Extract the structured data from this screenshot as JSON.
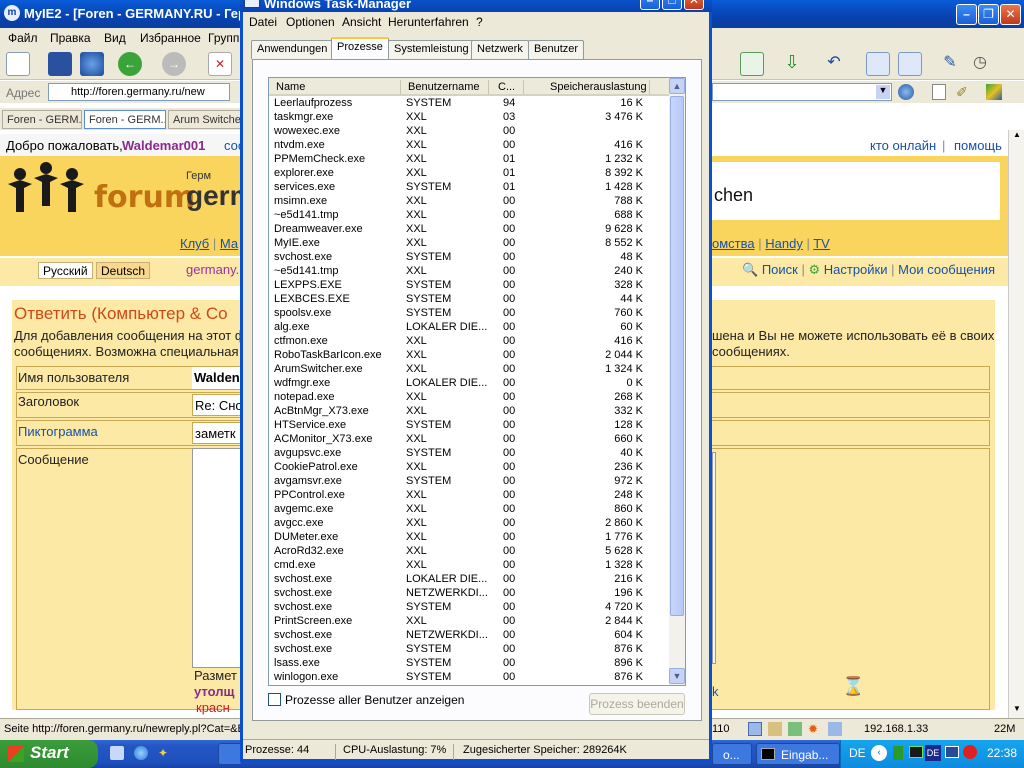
{
  "browser": {
    "title": "MyIE2 - [Foren - GERMANY.RU - Гер",
    "menu": [
      "Файл",
      "Правка",
      "Вид",
      "Избранное",
      "Групп"
    ],
    "address_label": "Адрес",
    "url": "http://foren.germany.ru/new",
    "tabs": [
      "Foren - GERM...",
      "Foren - GERM...",
      "Arum Switcher..."
    ],
    "status_text": "Seite http://foren.germany.ru/newreply.pl?Cat=&Bo",
    "status_count": "110",
    "status_ip": "192.168.1.33",
    "status_mem": "22M"
  },
  "page": {
    "welcome_prefix": "Добро пожаловать, ",
    "username": "Waldemar001",
    "welcome_tail": "соо",
    "who_online": "кто онлайн",
    "help": "помощь",
    "logo_word": "forum",
    "brand_word": "germ",
    "brand_small": "Герм",
    "header_right": "chen",
    "nav_left": [
      "Клуб",
      "Ма"
    ],
    "nav_right": [
      "омства",
      "Handy",
      "TV"
    ],
    "lang_ru": "Русский",
    "lang_de": "Deutsch",
    "germany_link": "germany.",
    "search": "Поиск",
    "settings": "Настройки",
    "my_messages": "Мои сообщения",
    "form_title": "Ответить (Компьютер & Со",
    "form_desc_left": "Для добавления сообщения на этот ф сообщениях. Возможна специальная р",
    "form_desc_right": "шена и Вы не можете использовать её в своих сообщениях.",
    "label_username": "Имя пользователя",
    "value_username": "Walden",
    "label_subject": "Заголовок",
    "value_subject": "Re: Сно",
    "label_icon": "Пиктограмма",
    "value_icon": "заметк",
    "label_message": "Сообщение",
    "razm": "Размет",
    "utol": "утолщ",
    "krasn": "красн",
    "right_k": "k"
  },
  "taskbar": {
    "start": "Start",
    "items": [
      "o...",
      "Eingab..."
    ],
    "lang": "DE",
    "time": "22:38"
  },
  "taskmgr": {
    "title": "Windows Task-Manager",
    "menu": [
      "Datei",
      "Optionen",
      "Ansicht",
      "Herunterfahren",
      "?"
    ],
    "tabs": [
      "Anwendungen",
      "Prozesse",
      "Systemleistung",
      "Netzwerk",
      "Benutzer"
    ],
    "active_tab": "Prozesse",
    "columns": [
      "Name",
      "Benutzername",
      "C...",
      "Speicherauslastung"
    ],
    "processes": [
      {
        "name": "Leerlaufprozess",
        "user": "SYSTEM",
        "cpu": "94",
        "mem": "16 K"
      },
      {
        "name": "taskmgr.exe",
        "user": "XXL",
        "cpu": "03",
        "mem": "3 476 K"
      },
      {
        "name": "  wowexec.exe",
        "user": "XXL",
        "cpu": "00",
        "mem": ""
      },
      {
        "name": "ntvdm.exe",
        "user": "XXL",
        "cpu": "00",
        "mem": "416 K"
      },
      {
        "name": "PPMemCheck.exe",
        "user": "XXL",
        "cpu": "01",
        "mem": "1 232 K"
      },
      {
        "name": "explorer.exe",
        "user": "XXL",
        "cpu": "01",
        "mem": "8 392 K"
      },
      {
        "name": "services.exe",
        "user": "SYSTEM",
        "cpu": "01",
        "mem": "1 428 K"
      },
      {
        "name": "msimn.exe",
        "user": "XXL",
        "cpu": "00",
        "mem": "788 K"
      },
      {
        "name": "~e5d141.tmp",
        "user": "XXL",
        "cpu": "00",
        "mem": "688 K"
      },
      {
        "name": "Dreamweaver.exe",
        "user": "XXL",
        "cpu": "00",
        "mem": "9 628 K"
      },
      {
        "name": "MyIE.exe",
        "user": "XXL",
        "cpu": "00",
        "mem": "8 552 K"
      },
      {
        "name": "svchost.exe",
        "user": "SYSTEM",
        "cpu": "00",
        "mem": "48 K"
      },
      {
        "name": "~e5d141.tmp",
        "user": "XXL",
        "cpu": "00",
        "mem": "240 K"
      },
      {
        "name": "LEXPPS.EXE",
        "user": "SYSTEM",
        "cpu": "00",
        "mem": "328 K"
      },
      {
        "name": "LEXBCES.EXE",
        "user": "SYSTEM",
        "cpu": "00",
        "mem": "44 K"
      },
      {
        "name": "spoolsv.exe",
        "user": "SYSTEM",
        "cpu": "00",
        "mem": "760 K"
      },
      {
        "name": "alg.exe",
        "user": "LOKALER DIE...",
        "cpu": "00",
        "mem": "60 K"
      },
      {
        "name": "ctfmon.exe",
        "user": "XXL",
        "cpu": "00",
        "mem": "416 K"
      },
      {
        "name": "RoboTaskBarIcon.exe",
        "user": "XXL",
        "cpu": "00",
        "mem": "2 044 K"
      },
      {
        "name": "ArumSwitcher.exe",
        "user": "XXL",
        "cpu": "00",
        "mem": "1 324 K"
      },
      {
        "name": "wdfmgr.exe",
        "user": "LOKALER DIE...",
        "cpu": "00",
        "mem": "0 K"
      },
      {
        "name": "notepad.exe",
        "user": "XXL",
        "cpu": "00",
        "mem": "268 K"
      },
      {
        "name": "AcBtnMgr_X73.exe",
        "user": "XXL",
        "cpu": "00",
        "mem": "332 K"
      },
      {
        "name": "HTService.exe",
        "user": "SYSTEM",
        "cpu": "00",
        "mem": "128 K"
      },
      {
        "name": "ACMonitor_X73.exe",
        "user": "XXL",
        "cpu": "00",
        "mem": "660 K"
      },
      {
        "name": "avgupsvc.exe",
        "user": "SYSTEM",
        "cpu": "00",
        "mem": "40 K"
      },
      {
        "name": "CookiePatrol.exe",
        "user": "XXL",
        "cpu": "00",
        "mem": "236 K"
      },
      {
        "name": "avgamsvr.exe",
        "user": "SYSTEM",
        "cpu": "00",
        "mem": "972 K"
      },
      {
        "name": "PPControl.exe",
        "user": "XXL",
        "cpu": "00",
        "mem": "248 K"
      },
      {
        "name": "avgemc.exe",
        "user": "XXL",
        "cpu": "00",
        "mem": "860 K"
      },
      {
        "name": "avgcc.exe",
        "user": "XXL",
        "cpu": "00",
        "mem": "2 860 K"
      },
      {
        "name": "DUMeter.exe",
        "user": "XXL",
        "cpu": "00",
        "mem": "1 776 K"
      },
      {
        "name": "AcroRd32.exe",
        "user": "XXL",
        "cpu": "00",
        "mem": "5 628 K"
      },
      {
        "name": "cmd.exe",
        "user": "XXL",
        "cpu": "00",
        "mem": "1 328 K"
      },
      {
        "name": "svchost.exe",
        "user": "LOKALER DIE...",
        "cpu": "00",
        "mem": "216 K"
      },
      {
        "name": "svchost.exe",
        "user": "NETZWERKDI...",
        "cpu": "00",
        "mem": "196 K"
      },
      {
        "name": "svchost.exe",
        "user": "SYSTEM",
        "cpu": "00",
        "mem": "4 720 K"
      },
      {
        "name": "PrintScreen.exe",
        "user": "XXL",
        "cpu": "00",
        "mem": "2 844 K"
      },
      {
        "name": "svchost.exe",
        "user": "NETZWERKDI...",
        "cpu": "00",
        "mem": "604 K"
      },
      {
        "name": "svchost.exe",
        "user": "SYSTEM",
        "cpu": "00",
        "mem": "876 K"
      },
      {
        "name": "lsass.exe",
        "user": "SYSTEM",
        "cpu": "00",
        "mem": "896 K"
      },
      {
        "name": "winlogon.exe",
        "user": "SYSTEM",
        "cpu": "00",
        "mem": "876 K"
      }
    ],
    "show_all_label": "Prozesse aller Benutzer anzeigen",
    "end_process": "Prozess beenden",
    "status_processes": "Prozesse: 44",
    "status_cpu": "CPU-Auslastung: 7%",
    "status_commit": "Zugesicherter Speicher: 289264K"
  }
}
